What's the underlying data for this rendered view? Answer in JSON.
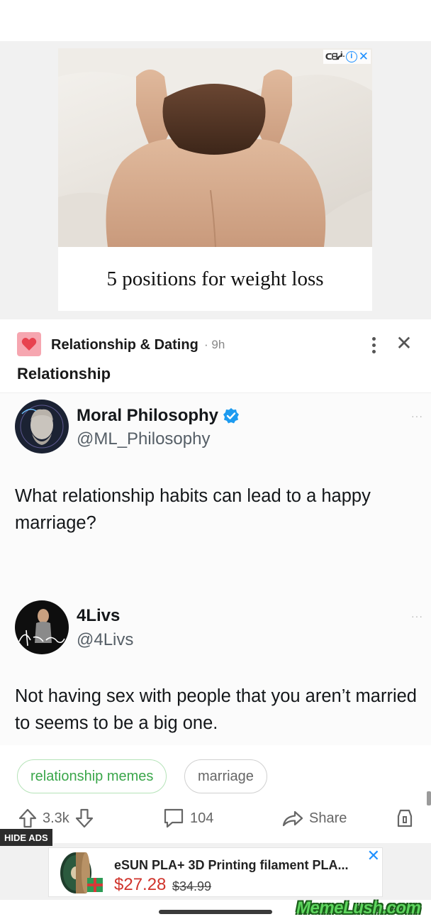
{
  "ad_top": {
    "caption": "5 positions for weight loss",
    "choices_logo": "ᑕᗺᓿ"
  },
  "post": {
    "community": "Relationship & Dating",
    "time": "· 9h",
    "title": "Relationship",
    "community_color": "#f6a6b0"
  },
  "tweets": [
    {
      "name": "Moral Philosophy",
      "handle": "@ML_Philosophy",
      "verified": true,
      "text": "What relationship habits can lead to a happy marriage?",
      "more": "···"
    },
    {
      "name": "4Livs",
      "handle": "@4Livs",
      "verified": false,
      "text": "Not having sex with people that you aren’t married to seems to be a big one.",
      "more": "···"
    }
  ],
  "tags": [
    "relationship memes",
    "marriage"
  ],
  "actions": {
    "upvotes": "3.3k",
    "comments": "104",
    "share": "Share"
  },
  "ad_bottom": {
    "hide_label": "HIDE ADS",
    "title": "eSUN PLA+ 3D Printing filament PLA...",
    "price": "$27.28",
    "old_price": "$34.99"
  },
  "watermark": "MemeLush.com",
  "colors": {
    "accent_green": "#3aa64a",
    "verified_blue": "#1d9bf0",
    "price_red": "#d0342c",
    "adchoices_blue": "#1e90ff"
  }
}
